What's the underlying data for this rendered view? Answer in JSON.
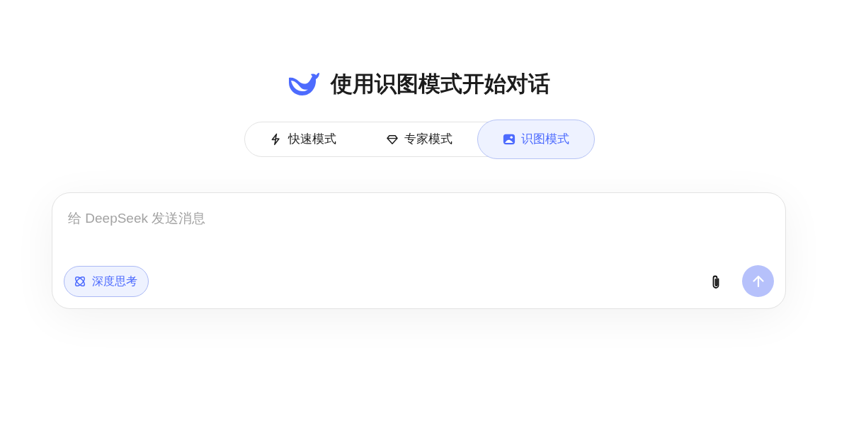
{
  "header": {
    "title": "使用识图模式开始对话"
  },
  "mode_tabs": [
    {
      "label": "快速模式",
      "kind": "bolt",
      "selected": false
    },
    {
      "label": "专家模式",
      "kind": "diamond",
      "selected": false
    },
    {
      "label": "识图模式",
      "kind": "image",
      "selected": true
    }
  ],
  "composer": {
    "placeholder": "给 DeepSeek 发送消息",
    "deep_think": {
      "label": "深度思考",
      "on": true
    },
    "send": {
      "disabled": true
    }
  }
}
